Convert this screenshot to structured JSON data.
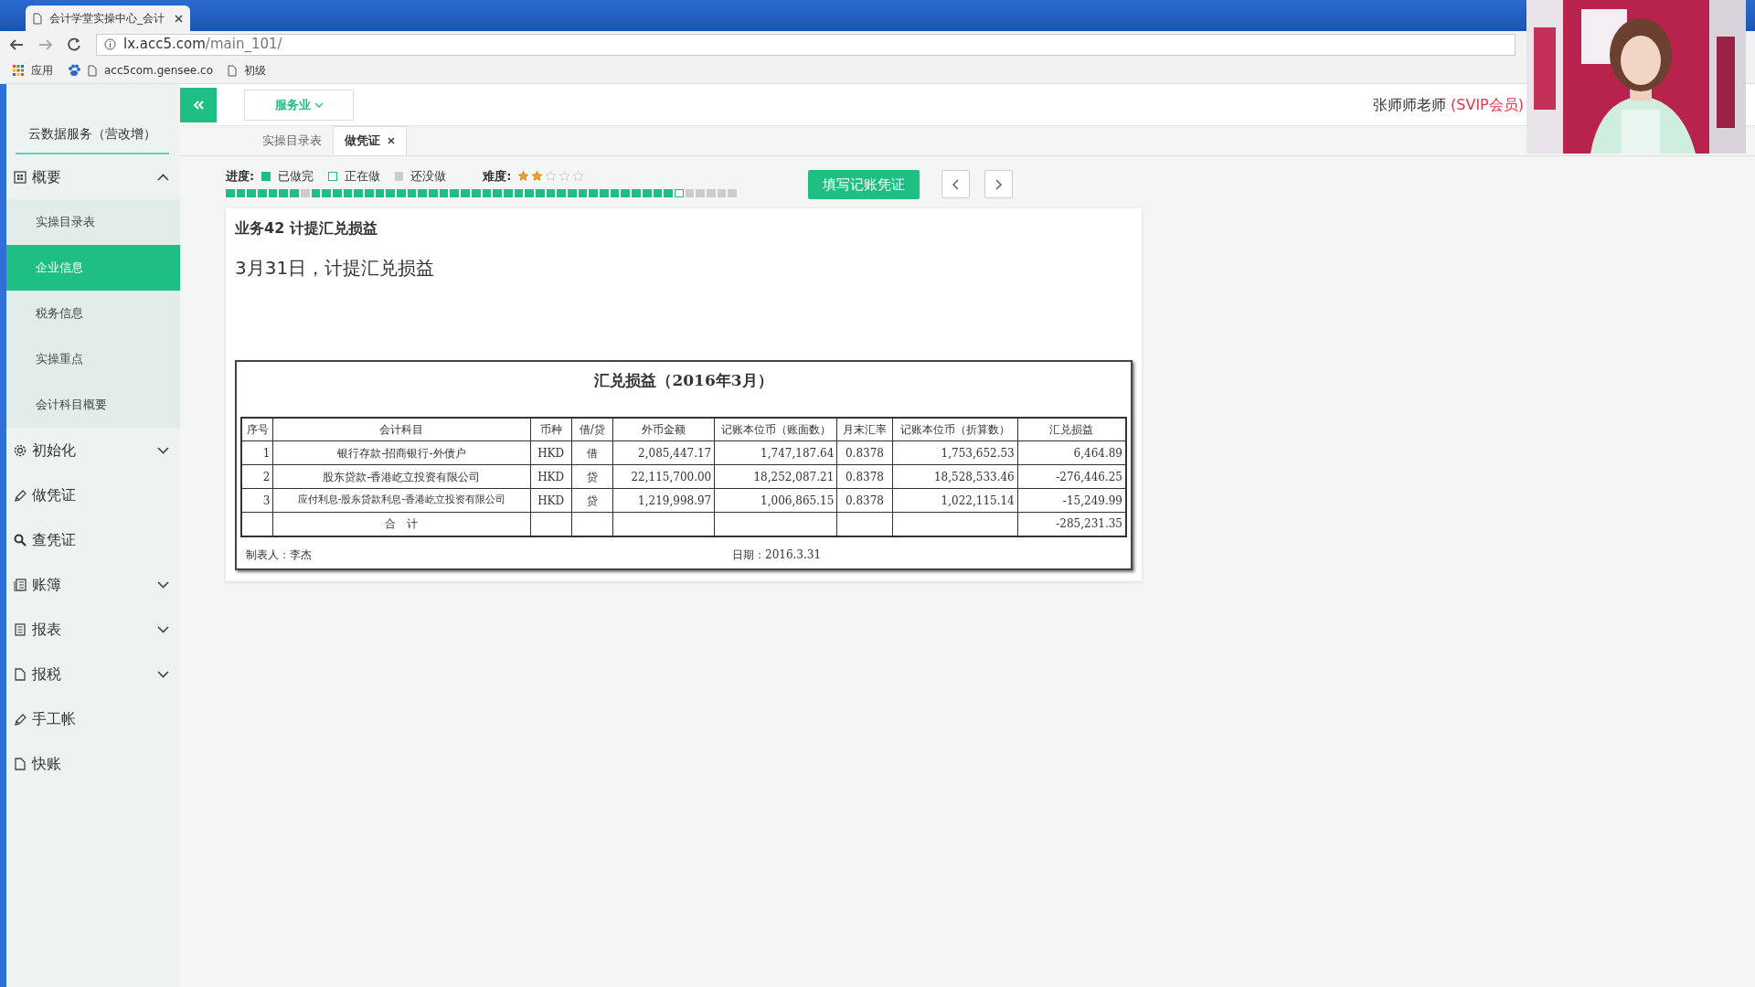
{
  "browser": {
    "tab_title": "会计学堂实操中心_会计",
    "address_domain": "lx.acc5.com",
    "address_path": "/main_101/",
    "bookmarks": [
      "应用",
      "acc5com.gensee.co",
      "初级"
    ]
  },
  "header": {
    "industry": "服务业",
    "user": "张师师老师",
    "membership": "(SVIP会员)"
  },
  "sidebar": {
    "title": "云数据服务（营改增）",
    "items": [
      {
        "label": "概要",
        "kind": "group",
        "expanded": true,
        "children": [
          {
            "label": "实操目录表",
            "selected": false
          },
          {
            "label": "企业信息",
            "selected": true
          },
          {
            "label": "税务信息",
            "selected": false
          },
          {
            "label": "实操重点",
            "selected": false
          },
          {
            "label": "会计科目概要",
            "selected": false
          }
        ]
      },
      {
        "label": "初始化",
        "kind": "group",
        "expanded": false
      },
      {
        "label": "做凭证",
        "kind": "link"
      },
      {
        "label": "查凭证",
        "kind": "link"
      },
      {
        "label": "账簿",
        "kind": "group",
        "expanded": false
      },
      {
        "label": "报表",
        "kind": "group",
        "expanded": false
      },
      {
        "label": "报税",
        "kind": "group",
        "expanded": false
      },
      {
        "label": "手工帐",
        "kind": "link"
      },
      {
        "label": "快账",
        "kind": "link"
      }
    ]
  },
  "tabs": [
    {
      "label": "实操目录表",
      "selected": false,
      "closable": false
    },
    {
      "label": "做凭证",
      "selected": true,
      "closable": true
    }
  ],
  "progress": {
    "label": "进度:",
    "legend": [
      {
        "label": "已做完",
        "kind": "done"
      },
      {
        "label": "正在做",
        "kind": "current"
      },
      {
        "label": "还没做",
        "kind": "todo"
      }
    ],
    "difficulty_label": "难度:",
    "stars": 2,
    "steps": [
      {
        "kind": "done"
      },
      {
        "kind": "done"
      },
      {
        "kind": "done"
      },
      {
        "kind": "done"
      },
      {
        "kind": "done"
      },
      {
        "kind": "done"
      },
      {
        "kind": "done"
      },
      {
        "kind": "todo"
      },
      {
        "kind": "done"
      },
      {
        "kind": "done"
      },
      {
        "kind": "done"
      },
      {
        "kind": "done"
      },
      {
        "kind": "done"
      },
      {
        "kind": "done"
      },
      {
        "kind": "done"
      },
      {
        "kind": "done"
      },
      {
        "kind": "done"
      },
      {
        "kind": "done"
      },
      {
        "kind": "done"
      },
      {
        "kind": "done"
      },
      {
        "kind": "done"
      },
      {
        "kind": "done"
      },
      {
        "kind": "done"
      },
      {
        "kind": "done"
      },
      {
        "kind": "done"
      },
      {
        "kind": "done"
      },
      {
        "kind": "done"
      },
      {
        "kind": "done"
      },
      {
        "kind": "done"
      },
      {
        "kind": "done"
      },
      {
        "kind": "done"
      },
      {
        "kind": "done"
      },
      {
        "kind": "done"
      },
      {
        "kind": "done"
      },
      {
        "kind": "done"
      },
      {
        "kind": "done"
      },
      {
        "kind": "done"
      },
      {
        "kind": "done"
      },
      {
        "kind": "done"
      },
      {
        "kind": "done"
      },
      {
        "kind": "done"
      },
      {
        "kind": "done"
      },
      {
        "kind": "current"
      },
      {
        "kind": "todo"
      },
      {
        "kind": "todo"
      },
      {
        "kind": "todo"
      },
      {
        "kind": "todo"
      },
      {
        "kind": "todo"
      }
    ]
  },
  "fill_button": "填写记账凭证",
  "task": {
    "title": "业务42 计提汇兑损益",
    "description": "3月31日，计提汇兑损益"
  },
  "sheet": {
    "title": "汇兑损益（2016年3月）",
    "columns": [
      "序号",
      "会计科目",
      "币种",
      "借/贷",
      "外币金额",
      "记账本位币（账面数）",
      "月末汇率",
      "记账本位币（折算数）",
      "汇兑损益"
    ],
    "rows": [
      [
        "1",
        "银行存款-招商银行-外债户",
        "HKD",
        "借",
        "2,085,447.17",
        "1,747,187.64",
        "0.8378",
        "1,753,652.53",
        "6,464.89"
      ],
      [
        "2",
        "股东贷款-香港屹立投资有限公司",
        "HKD",
        "贷",
        "22,115,700.00",
        "18,252,087.21",
        "0.8378",
        "18,528,533.46",
        "-276,446.25"
      ],
      [
        "3",
        "应付利息-股东贷款利息-香港屹立投资有限公司",
        "HKD",
        "贷",
        "1,219,998.97",
        "1,006,865.15",
        "0.8378",
        "1,022,115.14",
        "-15,249.99"
      ]
    ],
    "total": {
      "label": "合　计",
      "value": "-285,231.35"
    },
    "preparer": "制表人：李杰",
    "date": "日期：2016.3.31"
  }
}
